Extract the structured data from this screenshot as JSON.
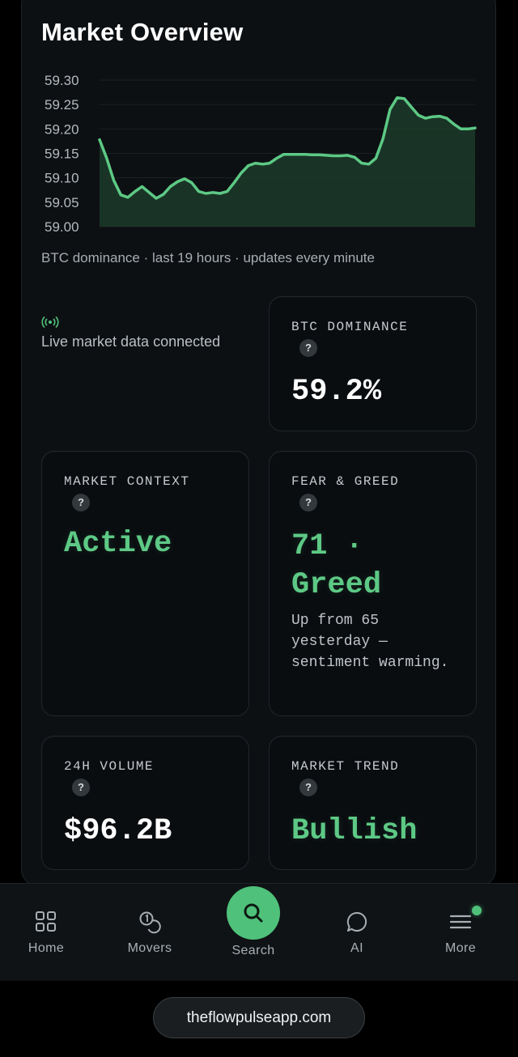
{
  "header": {
    "title": "Market Overview"
  },
  "chart_data": {
    "type": "area",
    "title": "",
    "xlabel": "",
    "ylabel": "",
    "ylim": [
      59.0,
      59.3
    ],
    "yticks": [
      "59.30",
      "59.25",
      "59.20",
      "59.15",
      "59.10",
      "59.05",
      "59.00"
    ],
    "grid": true,
    "line_color": "#5dc985",
    "fill_color": "#1c3b2a",
    "x": [
      0,
      1,
      2,
      3,
      4,
      5,
      6,
      7,
      8,
      9,
      10,
      11,
      12,
      13,
      14,
      15,
      16,
      17,
      18,
      19,
      20,
      21,
      22,
      23,
      24,
      25,
      26,
      27,
      28,
      29,
      30,
      31,
      32,
      33,
      34,
      35,
      36,
      37,
      38,
      39,
      40,
      41,
      42,
      43,
      44,
      45,
      46,
      47,
      48,
      49,
      50,
      51,
      52,
      53,
      54,
      55,
      56,
      57
    ],
    "values": [
      59.178,
      59.14,
      59.095,
      59.065,
      59.06,
      59.072,
      59.082,
      59.07,
      59.058,
      59.066,
      59.082,
      59.092,
      59.098,
      59.09,
      59.072,
      59.068,
      59.07,
      59.068,
      59.072,
      59.09,
      59.11,
      59.125,
      59.13,
      59.128,
      59.13,
      59.14,
      59.148,
      59.148,
      59.148,
      59.148,
      59.147,
      59.147,
      59.146,
      59.145,
      59.145,
      59.146,
      59.142,
      59.13,
      59.128,
      59.14,
      59.18,
      59.24,
      59.264,
      59.262,
      59.245,
      59.228,
      59.222,
      59.225,
      59.226,
      59.222,
      59.21,
      59.2,
      59.2,
      59.202
    ]
  },
  "chart_caption": "BTC dominance · last 19 hours · updates every minute",
  "live_status": "Live market data connected",
  "tiles": {
    "btc": {
      "label": "BTC DOMINANCE",
      "value": "59.2%"
    },
    "context": {
      "label": "MARKET CONTEXT",
      "value": "Active"
    },
    "fear_greed": {
      "label": "FEAR & GREED",
      "value": "71 · Greed",
      "note": "Up from 65 yesterday — sentiment warming."
    },
    "volume": {
      "label": "24H VOLUME",
      "value": "$96.2B"
    },
    "trend": {
      "label": "MARKET TREND",
      "value": "Bullish"
    }
  },
  "help_glyph": "?",
  "nav": {
    "home": "Home",
    "movers": "Movers",
    "search": "Search",
    "ai": "AI",
    "more": "More"
  },
  "footer": {
    "url": "theflowpulseapp.com"
  },
  "colors": {
    "accent": "#4fc17a",
    "background": "#000000",
    "card": "#0d1013"
  }
}
